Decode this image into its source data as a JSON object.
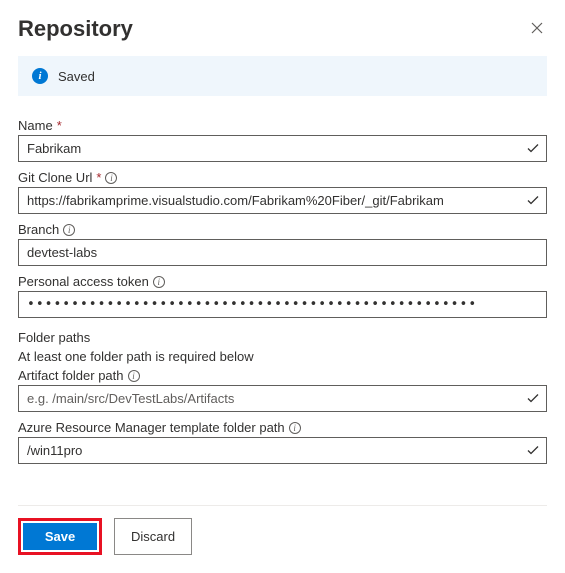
{
  "header": {
    "title": "Repository"
  },
  "notice": {
    "text": "Saved"
  },
  "fields": {
    "name": {
      "label": "Name",
      "value": "Fabrikam"
    },
    "git_url": {
      "label": "Git Clone Url",
      "value": "https://fabrikamprime.visualstudio.com/Fabrikam%20Fiber/_git/Fabrikam"
    },
    "branch": {
      "label": "Branch",
      "value": "devtest-labs"
    },
    "pat": {
      "label": "Personal access token",
      "masked": "•••••••••••••••••••••••••••••••••••••••••••••••••••"
    }
  },
  "folder": {
    "section": "Folder paths",
    "hint": "At least one folder path is required below",
    "artifact": {
      "label": "Artifact folder path",
      "placeholder": "e.g. /main/src/DevTestLabs/Artifacts",
      "value": ""
    },
    "arm": {
      "label": "Azure Resource Manager template folder path",
      "value": "/win11pro"
    }
  },
  "buttons": {
    "save": "Save",
    "discard": "Discard"
  }
}
